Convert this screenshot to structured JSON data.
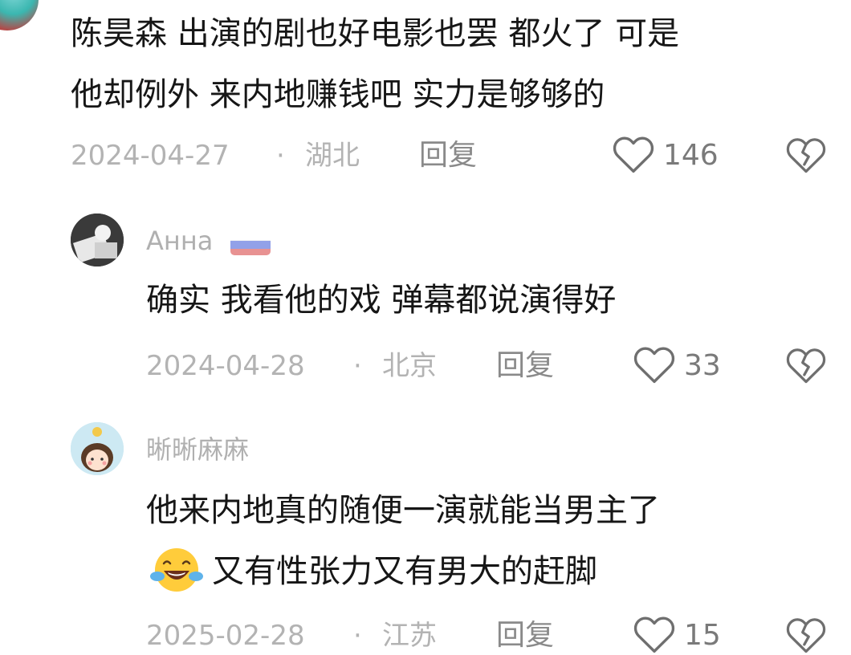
{
  "comments": [
    {
      "lines": [
        "陈昊森 出演的剧也好电影也罢 都火了 可是",
        "他却例外  来内地赚钱吧 实力是够够的"
      ],
      "date": "2024-04-27",
      "sep": "·",
      "region": "湖北",
      "reply": "回复",
      "likes": "146"
    },
    {
      "username": "Анна",
      "flag": "russia-flag",
      "lines": [
        "确实 我看他的戏  弹幕都说演得好"
      ],
      "date": "2024-04-28",
      "sep": "·",
      "region": "北京",
      "reply": "回复",
      "likes": "33"
    },
    {
      "username": "晰晰麻麻",
      "lines": [
        "他来内地真的随便一演就能当男主了",
        "又有性张力又有男大的赶脚"
      ],
      "emoji": "😂",
      "date": "2025-02-28",
      "sep": "·",
      "region": "江苏",
      "reply": "回复",
      "likes": "15"
    }
  ],
  "icons": {
    "like": "heart-outline-icon",
    "dislike": "broken-heart-icon"
  },
  "colors": {
    "text": "#161616",
    "meta": "#b3b3b3",
    "icon": "#6f6f6f"
  }
}
